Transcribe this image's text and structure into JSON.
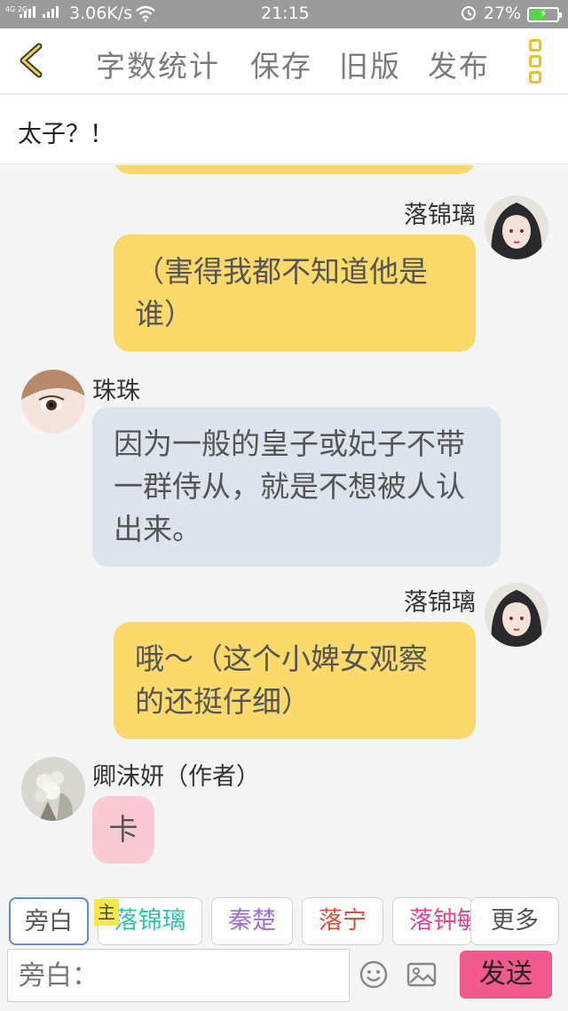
{
  "status_bar": {
    "network": "4G 2G",
    "speed": "3.06K/s",
    "time": "21:15",
    "battery": "27%"
  },
  "toolbar": {
    "word_count": "字数统计",
    "save": "保存",
    "old_version": "旧版",
    "publish": "发布"
  },
  "story": {
    "title": "太子？！"
  },
  "messages": [
    {
      "speaker": "落锦璃",
      "text": "（害得我都不知道他是谁）"
    },
    {
      "speaker": "珠珠",
      "text": "因为一般的皇子或妃子不带一群侍从，就是不想被人认出来。"
    },
    {
      "speaker": "落锦璃",
      "text": "哦～（这个小婢女观察的还挺仔细）"
    },
    {
      "speaker": "卿沫妍（作者）",
      "text": "卡"
    }
  ],
  "roles": [
    {
      "label": "旁白",
      "color": "#555555"
    },
    {
      "label": "落锦璃",
      "color": "#2fc4b2"
    },
    {
      "label": "秦楚",
      "color": "#a36bd6"
    },
    {
      "label": "落宁",
      "color": "#e84a3c"
    },
    {
      "label": "落钟敏",
      "color": "#e0459a"
    },
    {
      "label": "更多",
      "color": "#555555"
    }
  ],
  "host_tag": "主",
  "composer": {
    "placeholder": "旁白：",
    "send": "发送"
  }
}
